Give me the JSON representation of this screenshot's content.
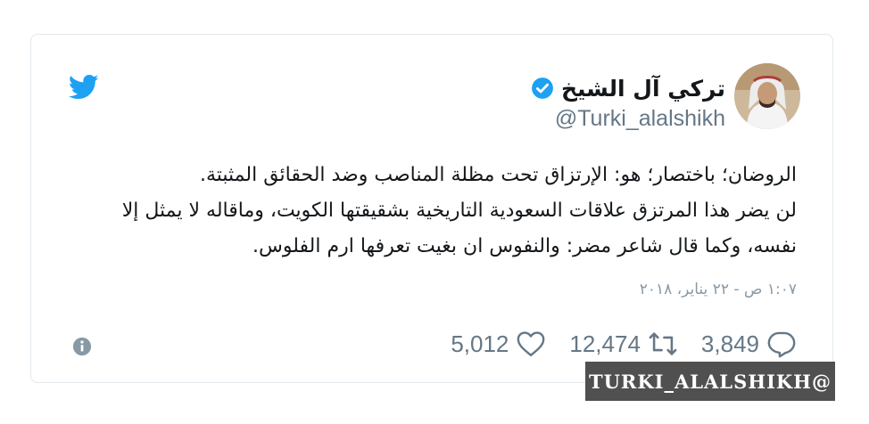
{
  "author": {
    "display_name": "تركي آل الشيخ",
    "handle": "@Turki_alalshikh",
    "verified": true
  },
  "tweet": {
    "lines": [
      "الروضان؛ باختصار؛ هو: الإرتزاق تحت مظلة المناصب وضد الحقائق المثبتة.",
      "لن يضر هذا المرتزق علاقات السعودية التاريخية بشقيقتها الكويت، وماقاله لا يمثل إلا",
      "نفسه، وكما قال شاعر مضر: والنفوس ان بغيت تعرفها ارم الفلوس."
    ],
    "timestamp": "١:٠٧ ص - ٢٢ يناير، ٢٠١٨"
  },
  "actions": {
    "replies": "3,849",
    "retweets": "12,474",
    "likes": "5,012"
  },
  "icons": {
    "brand": "twitter-bird-icon",
    "verified": "verified-badge-icon",
    "info": "info-icon",
    "reply": "reply-icon",
    "retweet": "retweet-icon",
    "like": "heart-icon"
  },
  "colors": {
    "twitter_blue": "#1da1f2",
    "text": "#14171a",
    "muted": "#657786",
    "watermark_bg": "#505050"
  },
  "watermark": {
    "text": "TURKI_ALALSHIKH@"
  }
}
